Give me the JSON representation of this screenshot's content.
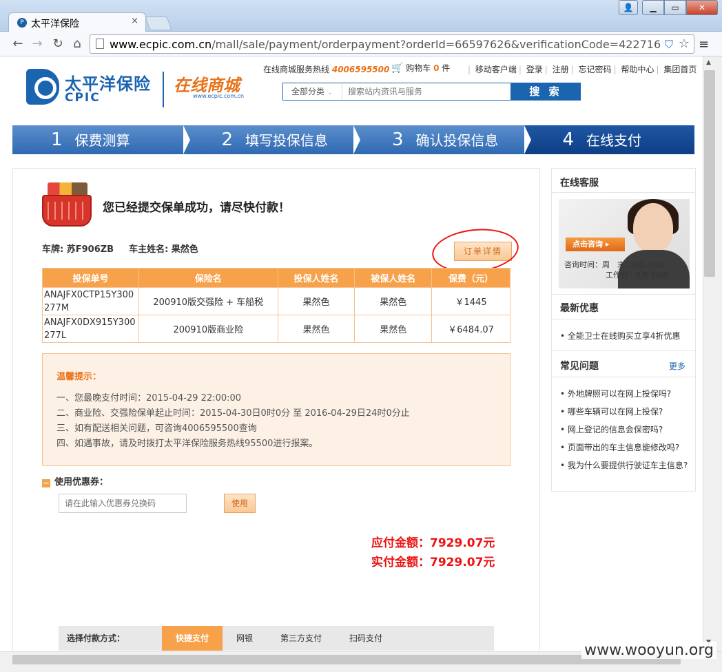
{
  "browser": {
    "tab_title": "太平洋保险",
    "tab_close": "×",
    "win_min": "▁",
    "win_max": "▭",
    "win_close": "✕",
    "win_user": "👤",
    "url_host": "www.ecpic.com.cn",
    "url_path": "/mall/sale/payment/orderpayment?orderId=66597626&verificationCode=422716",
    "back": "←",
    "forward": "→",
    "reload": "↻",
    "home": "⌂",
    "menu": "≡"
  },
  "header": {
    "logo_cn": "太平洋保险",
    "logo_en": "CPIC",
    "mall_cn": "在线商城",
    "mall_url": "www.ecpic.com.cn",
    "hotline_label": "在线商城服务热线",
    "hotline_number": "4006595500",
    "cart_label": "购物车",
    "cart_count": "0",
    "cart_unit": "件",
    "links": [
      "移动客户端",
      "登录",
      "注册",
      "忘记密码",
      "帮助中心",
      "集团首页"
    ],
    "search_category": "全部分类",
    "search_placeholder": "搜索站内资讯与服务",
    "search_button": "搜 索"
  },
  "steps": [
    {
      "num": "1",
      "label": "保费测算"
    },
    {
      "num": "2",
      "label": "填写投保信息"
    },
    {
      "num": "3",
      "label": "确认投保信息"
    },
    {
      "num": "4",
      "label": "在线支付"
    }
  ],
  "main": {
    "success_msg": "您已经提交保单成功，请尽快付款！",
    "plate_label": "车牌: 苏F906ZB",
    "owner_label": "车主姓名: 果然色",
    "order_detail_btn": "订单详情",
    "table": {
      "headers": [
        "投保单号",
        "保险名",
        "投保人姓名",
        "被保人姓名",
        "保费（元）"
      ],
      "rows": [
        [
          "ANAJFX0CTP15Y300277M",
          "200910版交强险 + 车船税",
          "果然色",
          "果然色",
          "￥1445"
        ],
        [
          "ANAJFX0DX915Y300277L",
          "200910版商业险",
          "果然色",
          "果然色",
          "￥6484.07"
        ]
      ],
      "row_no_lines": [
        [
          "ANAJFX0CTP15Y300",
          "277M"
        ],
        [
          "ANAJFX0DX915Y300",
          "277L"
        ]
      ]
    },
    "tips_title": "温馨提示：",
    "tips": [
      "一、您最晚支付时间：2015-04-29 22:00:00",
      "二、商业险、交强险保单起止时间：2015-04-30日0时0分 至 2016-04-29日24时0分止",
      "三、如有配送相关问题，可咨询4006595500查询",
      "四、如遇事故，请及时拨打太平洋保险服务热线95500进行报案。"
    ],
    "coupon_minus": "−",
    "coupon_title": "使用优惠券：",
    "coupon_placeholder": "请在此输入优惠券兑换码",
    "coupon_btn": "使用",
    "amount_due": "应付金额：7929.07元",
    "amount_paid": "实付金额：7929.07元",
    "pay_label": "选择付款方式：",
    "pay_options": [
      "快捷支付",
      "网银",
      "第三方支付",
      "扫码支付"
    ]
  },
  "sidebar": {
    "cs_title": "在线客服",
    "cs_btn": "点击咨询 ▸",
    "cs_hours_1": "咨询时间：周　末：9点-18点",
    "cs_hours_2": "工作日：8点-20点",
    "promo_title": "最新优惠",
    "promo_items": [
      "全能卫士在线购买立享4折优惠"
    ],
    "faq_title": "常见问题",
    "faq_more": "更多",
    "faq_items": [
      "外地牌照可以在网上投保吗?",
      "哪些车辆可以在网上投保?",
      "网上登记的信息会保密吗?",
      "页面带出的车主信息能修改吗?",
      "我为什么要提供行驶证车主信息?"
    ]
  },
  "watermark": "www.wooyun.org"
}
